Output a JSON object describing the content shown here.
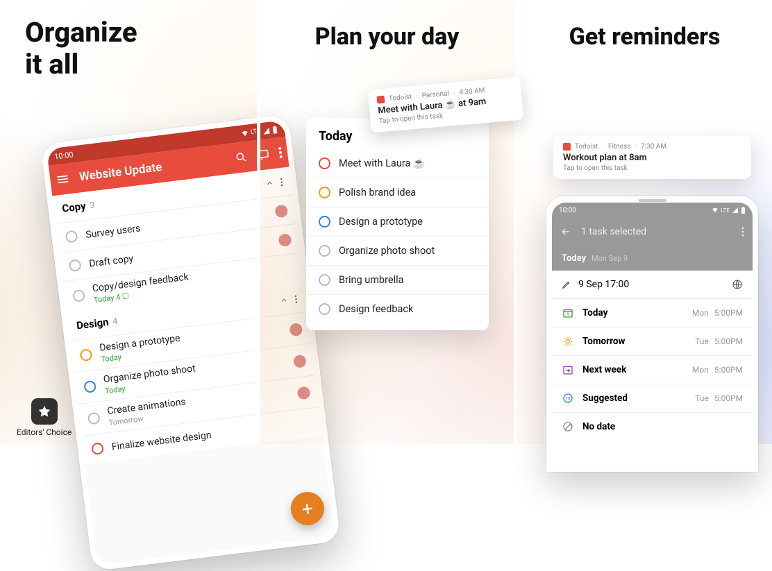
{
  "panel1": {
    "heading": "Organize\nit all",
    "status_time": "10:00",
    "status_lte": "LTE",
    "appbar_title": "Website Update",
    "section1": {
      "name": "Copy",
      "count": "3"
    },
    "tasks1": [
      {
        "title": "Survey users",
        "meta": ""
      },
      {
        "title": "Draft copy",
        "meta": ""
      },
      {
        "title": "Copy/design feedback",
        "meta": "Today  4 ☐"
      }
    ],
    "section2": {
      "name": "Design",
      "count": "4"
    },
    "tasks2": [
      {
        "title": "Design a prototype",
        "meta": "Today",
        "ring": "#f39c12"
      },
      {
        "title": "Organize photo shoot",
        "meta": "Today",
        "ring": "#2e86de"
      },
      {
        "title": "Create animations",
        "meta": "Tomorrow",
        "ring": "#bbb"
      },
      {
        "title": "Finalize website design",
        "meta": "",
        "ring": "#e74c3c"
      }
    ],
    "editors_choice": "Editors' Choice"
  },
  "panel2": {
    "heading": "Plan your day",
    "card_title": "Today",
    "tasks": [
      {
        "title": "Meet with Laura ☕",
        "ring": "#e74c3c"
      },
      {
        "title": "Polish brand idea",
        "ring": "#f39c12"
      },
      {
        "title": "Design a prototype",
        "ring": "#2e86de"
      },
      {
        "title": "Organize photo shoot",
        "ring": "#ccc"
      },
      {
        "title": "Bring umbrella",
        "ring": "#ccc"
      },
      {
        "title": "Design feedback",
        "ring": "#ccc"
      }
    ],
    "notif": {
      "app": "Todoist",
      "channel": "Personal",
      "time": "4:30 AM",
      "title": "Meet with Laura ☕ at 9am",
      "sub": "Tap to open this task"
    }
  },
  "panel3": {
    "heading": "Get reminders",
    "notif": {
      "app": "Todoist",
      "channel": "Fitness",
      "time": "7:30 AM",
      "title": "Workout plan at 8am",
      "sub": "Tap to open this task"
    },
    "status_time": "10:00",
    "status_lte": "LTE",
    "selected_text": "1 task selected",
    "today_label": "Today",
    "today_date": "Mon Sep 9",
    "input_value": "9 Sep 17:00",
    "schedule": [
      {
        "icon": "today",
        "label": "Today",
        "day": "Mon",
        "time": "5:00PM",
        "color": "#29a329"
      },
      {
        "icon": "sun",
        "label": "Tomorrow",
        "day": "Tue",
        "time": "5:00PM",
        "color": "#f39c12"
      },
      {
        "icon": "nextweek",
        "label": "Next week",
        "day": "Mon",
        "time": "5:00PM",
        "color": "#8e44ad"
      },
      {
        "icon": "suggested",
        "label": "Suggested",
        "day": "Tue",
        "time": "5:00PM",
        "color": "#2e86de"
      },
      {
        "icon": "nodate",
        "label": "No date",
        "day": "",
        "time": "",
        "color": "#888"
      }
    ]
  }
}
